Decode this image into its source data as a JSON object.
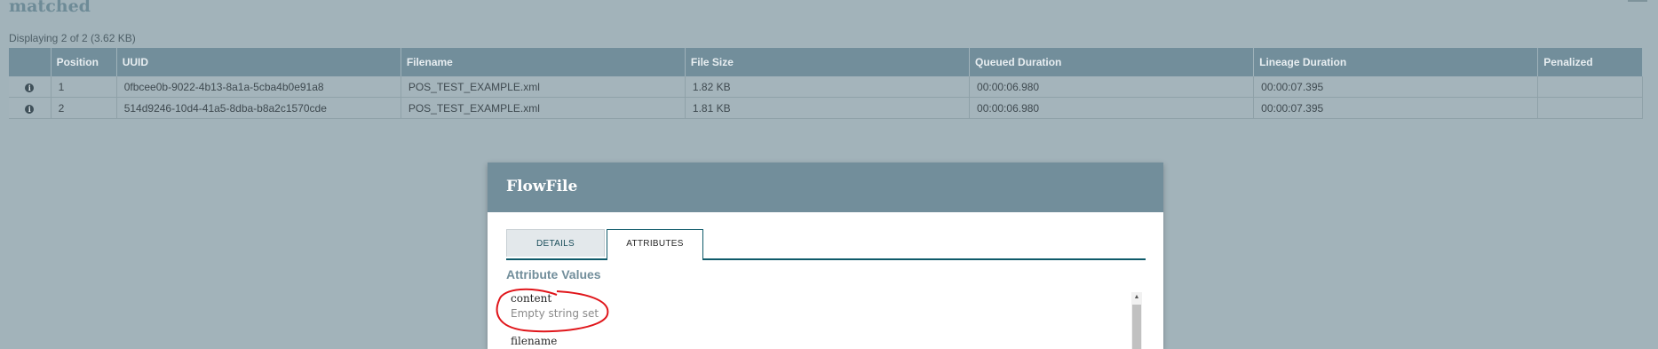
{
  "page": {
    "title": "matched",
    "display_count": "Displaying 2 of 2 (3.62 KB)"
  },
  "table": {
    "headers": [
      "",
      "Position",
      "UUID",
      "Filename",
      "File Size",
      "Queued Duration",
      "Lineage Duration",
      "Penalized"
    ],
    "rows": [
      {
        "info_icon": "info-icon",
        "position": "1",
        "uuid": "0fbcee0b-9022-4b13-8a1a-5cba4b0e91a8",
        "filename": "POS_TEST_EXAMPLE.xml",
        "file_size": "1.82 KB",
        "queued_duration": "00:00:06.980",
        "lineage_duration": "00:00:07.395",
        "penalized": ""
      },
      {
        "info_icon": "info-icon",
        "position": "2",
        "uuid": "514d9246-10d4-41a5-8dba-b8a2c1570cde",
        "filename": "POS_TEST_EXAMPLE.xml",
        "file_size": "1.81 KB",
        "queued_duration": "00:00:06.980",
        "lineage_duration": "00:00:07.395",
        "penalized": ""
      }
    ]
  },
  "dialog": {
    "title": "FlowFile",
    "tabs": [
      {
        "label": "DETAILS",
        "selected": false
      },
      {
        "label": "ATTRIBUTES",
        "selected": true
      }
    ],
    "section_title": "Attribute Values",
    "attributes": [
      {
        "name": "content",
        "value": "Empty string set"
      },
      {
        "name": "filename",
        "value": ""
      }
    ]
  },
  "colors": {
    "background": "#a2b3ba",
    "header_bar": "#728e9b",
    "accent": "#0f5a6a",
    "annotation": "#e0161b"
  },
  "icons": {
    "info": "info-icon",
    "scroll_up": "scroll-up-arrow-icon"
  }
}
